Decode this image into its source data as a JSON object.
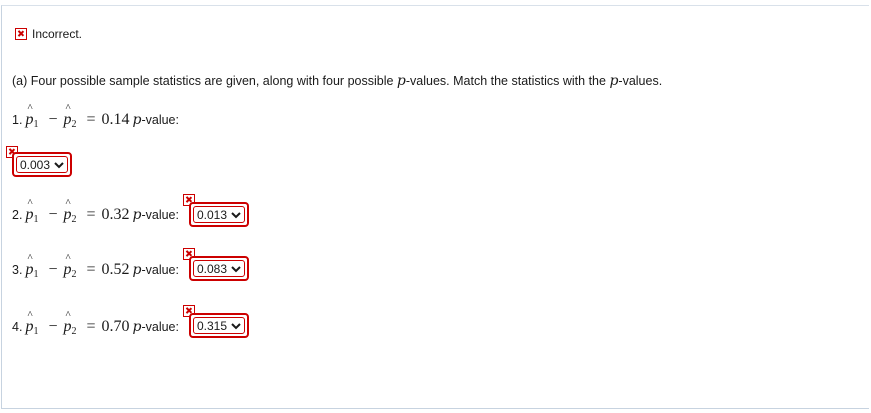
{
  "status": {
    "icon": "incorrect-x-icon",
    "text": "Incorrect."
  },
  "question": {
    "prefix": "(a) Four possible sample statistics are given, along with four possible ",
    "var1": "p",
    "middle": "-values. Match the statistics with the ",
    "var2": "p",
    "suffix": "-values."
  },
  "items": [
    {
      "number": "1.",
      "value": "0.14",
      "p_var": "p",
      "label": "-value:",
      "selected": "0.003",
      "status_icon": "incorrect-x-icon"
    },
    {
      "number": "2.",
      "value": "0.32",
      "p_var": "p",
      "label": "-value:",
      "selected": "0.013",
      "status_icon": "incorrect-x-icon"
    },
    {
      "number": "3.",
      "value": "0.52",
      "p_var": "p",
      "label": "-value:",
      "selected": "0.083",
      "status_icon": "incorrect-x-icon"
    },
    {
      "number": "4.",
      "value": "0.70",
      "p_var": "p",
      "label": "-value:",
      "selected": "0.315",
      "status_icon": "incorrect-x-icon"
    }
  ],
  "math": {
    "p_hat": "p",
    "sub1": "1",
    "sub2": "2",
    "minus": "−",
    "equals": "="
  },
  "colors": {
    "incorrect": "#cc0000",
    "panel_border": "#c7d3e0"
  }
}
